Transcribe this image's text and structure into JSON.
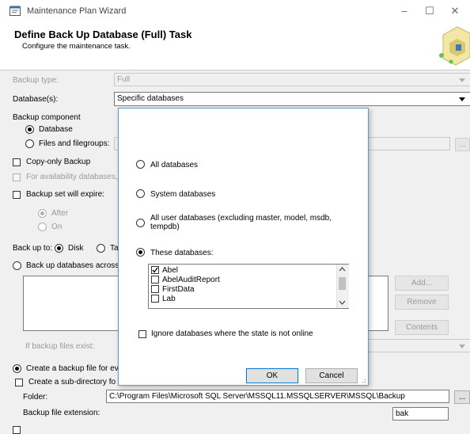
{
  "window": {
    "title": "Maintenance Plan Wizard",
    "minimize": "–",
    "maximize": "☐",
    "close": "✕"
  },
  "header": {
    "title": "Define Back Up Database (Full) Task",
    "subtitle": "Configure the maintenance task."
  },
  "backup_type": {
    "label": "Backup type:",
    "value": "Full"
  },
  "databases": {
    "label": "Database(s):",
    "value": "Specific databases"
  },
  "backup_component": {
    "label": "Backup component",
    "database": "Database",
    "files": "Files and filegroups:"
  },
  "copy_only": "Copy-only Backup",
  "availability": "For availability databases, ig",
  "expire": {
    "label": "Backup set will expire:",
    "after": "After",
    "on": "On"
  },
  "back_up_to": {
    "label": "Back up to:",
    "disk": "Disk",
    "tape": "Ta"
  },
  "across": "Back up databases across",
  "side_buttons": {
    "add": "Add...",
    "remove": "Remove",
    "contents": "Contents",
    "ellipsis": "..."
  },
  "if_exist": "If backup files exist:",
  "create_file": {
    "label": "Create a backup file for eve",
    "subdir": "Create a sub-directory fo"
  },
  "folder": {
    "label": "Folder:",
    "value": "C:\\Program Files\\Microsoft SQL Server\\MSSQL11.MSSQLSERVER\\MSSQL\\Backup"
  },
  "extension": {
    "label": "Backup file extension:",
    "value": "bak"
  },
  "popup": {
    "all": "All databases",
    "system": "System databases",
    "all_user": "All user databases  (excluding master, model, msdb, tempdb)",
    "these": "These databases:",
    "db_list": [
      {
        "name": "Abel",
        "checked": true
      },
      {
        "name": "AbelAuditReport",
        "checked": false
      },
      {
        "name": "FirstData",
        "checked": false
      },
      {
        "name": "Lab",
        "checked": false
      }
    ],
    "ignore": "Ignore databases where the state is not online",
    "ok": "OK",
    "cancel": "Cancel"
  }
}
